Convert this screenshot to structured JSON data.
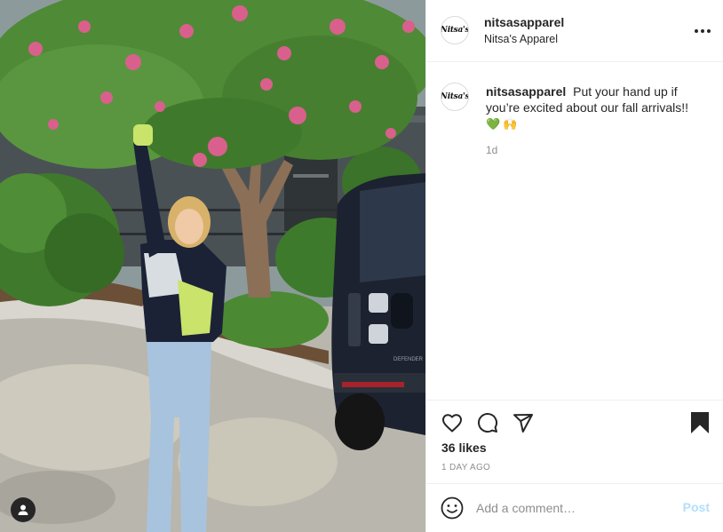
{
  "post": {
    "image_alt": "Woman in a black, white and lime sweater and light-wash flared jeans raising one hand in front of a flowering crape myrtle tree next to a dark SUV",
    "car_badge": "DEFENDER"
  },
  "header": {
    "avatar_text": "Nitsa's",
    "username": "nitsasapparel",
    "subtitle": "Nitsa's Apparel",
    "more_icon": "more-horizontal-icon"
  },
  "caption": {
    "avatar_text": "Nitsa's",
    "username": "nitsasapparel",
    "text": "Put your hand up if you’re excited about our fall arrivals!!",
    "emoji_1": "💚",
    "emoji_2": "🙌",
    "time": "1d"
  },
  "actions": {
    "icons": [
      "heart-icon",
      "comment-icon",
      "share-icon",
      "bookmark-icon"
    ],
    "bookmark_saved": true
  },
  "likes": {
    "text": "36 likes"
  },
  "date": {
    "text": "1 DAY AGO"
  },
  "add_comment": {
    "placeholder": "Add a comment…",
    "post_label": "Post",
    "emoji_icon": "smiley-icon"
  },
  "colors": {
    "text": "#262626",
    "muted": "#8e8e8e",
    "border": "#efefef",
    "post_disabled": "#b2dffc",
    "green_heart": "#3cb043"
  }
}
